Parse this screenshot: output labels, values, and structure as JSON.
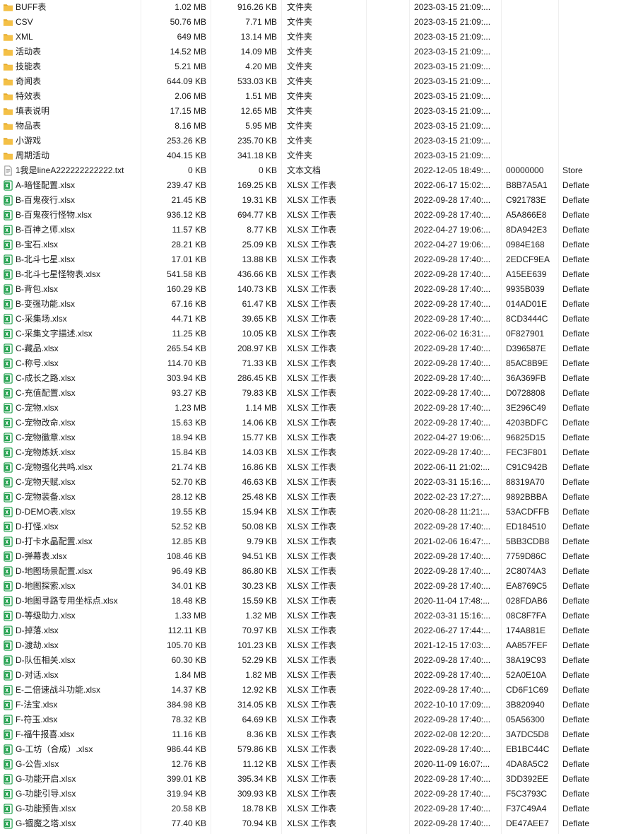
{
  "files": [
    {
      "name": "BUFF表",
      "size": "1.02 MB",
      "packed": "916.26 KB",
      "type": "文件夹",
      "modified": "2023-03-15 21:09:...",
      "crc": "",
      "method": "",
      "icon": "folder-icon"
    },
    {
      "name": "CSV",
      "size": "50.76 MB",
      "packed": "7.71 MB",
      "type": "文件夹",
      "modified": "2023-03-15 21:09:...",
      "crc": "",
      "method": "",
      "icon": "folder-icon"
    },
    {
      "name": "XML",
      "size": "649 MB",
      "packed": "13.14 MB",
      "type": "文件夹",
      "modified": "2023-03-15 21:09:...",
      "crc": "",
      "method": "",
      "icon": "folder-icon"
    },
    {
      "name": "活动表",
      "size": "14.52 MB",
      "packed": "14.09 MB",
      "type": "文件夹",
      "modified": "2023-03-15 21:09:...",
      "crc": "",
      "method": "",
      "icon": "folder-icon"
    },
    {
      "name": "技能表",
      "size": "5.21 MB",
      "packed": "4.20 MB",
      "type": "文件夹",
      "modified": "2023-03-15 21:09:...",
      "crc": "",
      "method": "",
      "icon": "folder-icon"
    },
    {
      "name": "奇闻表",
      "size": "644.09 KB",
      "packed": "533.03 KB",
      "type": "文件夹",
      "modified": "2023-03-15 21:09:...",
      "crc": "",
      "method": "",
      "icon": "folder-icon"
    },
    {
      "name": "特效表",
      "size": "2.06 MB",
      "packed": "1.51 MB",
      "type": "文件夹",
      "modified": "2023-03-15 21:09:...",
      "crc": "",
      "method": "",
      "icon": "folder-icon"
    },
    {
      "name": "填表说明",
      "size": "17.15 MB",
      "packed": "12.65 MB",
      "type": "文件夹",
      "modified": "2023-03-15 21:09:...",
      "crc": "",
      "method": "",
      "icon": "folder-icon"
    },
    {
      "name": "物品表",
      "size": "8.16 MB",
      "packed": "5.95 MB",
      "type": "文件夹",
      "modified": "2023-03-15 21:09:...",
      "crc": "",
      "method": "",
      "icon": "folder-icon"
    },
    {
      "name": "小游戏",
      "size": "253.26 KB",
      "packed": "235.70 KB",
      "type": "文件夹",
      "modified": "2023-03-15 21:09:...",
      "crc": "",
      "method": "",
      "icon": "folder-icon"
    },
    {
      "name": "周期活动",
      "size": "404.15 KB",
      "packed": "341.18 KB",
      "type": "文件夹",
      "modified": "2023-03-15 21:09:...",
      "crc": "",
      "method": "",
      "icon": "folder-icon"
    },
    {
      "name": "1我是lineA222222222222.txt",
      "size": "0 KB",
      "packed": "0 KB",
      "type": "文本文档",
      "modified": "2022-12-05 18:49:...",
      "crc": "00000000",
      "method": "Store",
      "icon": "text-file-icon"
    },
    {
      "name": "A-暗怪配置.xlsx",
      "size": "239.47 KB",
      "packed": "169.25 KB",
      "type": "XLSX 工作表",
      "modified": "2022-06-17 15:02:...",
      "crc": "B8B7A5A1",
      "method": "Deflate",
      "icon": "xlsx-file-icon"
    },
    {
      "name": "B-百鬼夜行.xlsx",
      "size": "21.45 KB",
      "packed": "19.31 KB",
      "type": "XLSX 工作表",
      "modified": "2022-09-28 17:40:...",
      "crc": "C921783E",
      "method": "Deflate",
      "icon": "xlsx-file-icon"
    },
    {
      "name": "B-百鬼夜行怪物.xlsx",
      "size": "936.12 KB",
      "packed": "694.77 KB",
      "type": "XLSX 工作表",
      "modified": "2022-09-28 17:40:...",
      "crc": "A5A866E8",
      "method": "Deflate",
      "icon": "xlsx-file-icon"
    },
    {
      "name": "B-百神之师.xlsx",
      "size": "11.57 KB",
      "packed": "8.77 KB",
      "type": "XLSX 工作表",
      "modified": "2022-04-27 19:06:...",
      "crc": "8DA942E3",
      "method": "Deflate",
      "icon": "xlsx-file-icon"
    },
    {
      "name": "B-宝石.xlsx",
      "size": "28.21 KB",
      "packed": "25.09 KB",
      "type": "XLSX 工作表",
      "modified": "2022-04-27 19:06:...",
      "crc": "0984E168",
      "method": "Deflate",
      "icon": "xlsx-file-icon"
    },
    {
      "name": "B-北斗七星.xlsx",
      "size": "17.01 KB",
      "packed": "13.88 KB",
      "type": "XLSX 工作表",
      "modified": "2022-09-28 17:40:...",
      "crc": "2EDCF9EA",
      "method": "Deflate",
      "icon": "xlsx-file-icon"
    },
    {
      "name": "B-北斗七星怪物表.xlsx",
      "size": "541.58 KB",
      "packed": "436.66 KB",
      "type": "XLSX 工作表",
      "modified": "2022-09-28 17:40:...",
      "crc": "A15EE639",
      "method": "Deflate",
      "icon": "xlsx-file-icon"
    },
    {
      "name": "B-背包.xlsx",
      "size": "160.29 KB",
      "packed": "140.73 KB",
      "type": "XLSX 工作表",
      "modified": "2022-09-28 17:40:...",
      "crc": "9935B039",
      "method": "Deflate",
      "icon": "xlsx-file-icon"
    },
    {
      "name": "B-变强功能.xlsx",
      "size": "67.16 KB",
      "packed": "61.47 KB",
      "type": "XLSX 工作表",
      "modified": "2022-09-28 17:40:...",
      "crc": "014AD01E",
      "method": "Deflate",
      "icon": "xlsx-file-icon"
    },
    {
      "name": "C-采集场.xlsx",
      "size": "44.71 KB",
      "packed": "39.65 KB",
      "type": "XLSX 工作表",
      "modified": "2022-09-28 17:40:...",
      "crc": "8CD3444C",
      "method": "Deflate",
      "icon": "xlsx-file-icon"
    },
    {
      "name": "C-采集文字描述.xlsx",
      "size": "11.25 KB",
      "packed": "10.05 KB",
      "type": "XLSX 工作表",
      "modified": "2022-06-02 16:31:...",
      "crc": "0F827901",
      "method": "Deflate",
      "icon": "xlsx-file-icon"
    },
    {
      "name": "C-藏品.xlsx",
      "size": "265.54 KB",
      "packed": "208.97 KB",
      "type": "XLSX 工作表",
      "modified": "2022-09-28 17:40:...",
      "crc": "D396587E",
      "method": "Deflate",
      "icon": "xlsx-file-icon"
    },
    {
      "name": "C-称号.xlsx",
      "size": "114.70 KB",
      "packed": "71.33 KB",
      "type": "XLSX 工作表",
      "modified": "2022-09-28 17:40:...",
      "crc": "85AC8B9E",
      "method": "Deflate",
      "icon": "xlsx-file-icon"
    },
    {
      "name": "C-成长之路.xlsx",
      "size": "303.94 KB",
      "packed": "286.45 KB",
      "type": "XLSX 工作表",
      "modified": "2022-09-28 17:40:...",
      "crc": "36A369FB",
      "method": "Deflate",
      "icon": "xlsx-file-icon"
    },
    {
      "name": "C-充值配置.xlsx",
      "size": "93.27 KB",
      "packed": "79.83 KB",
      "type": "XLSX 工作表",
      "modified": "2022-09-28 17:40:...",
      "crc": "D0728808",
      "method": "Deflate",
      "icon": "xlsx-file-icon"
    },
    {
      "name": "C-宠物.xlsx",
      "size": "1.23 MB",
      "packed": "1.14 MB",
      "type": "XLSX 工作表",
      "modified": "2022-09-28 17:40:...",
      "crc": "3E296C49",
      "method": "Deflate",
      "icon": "xlsx-file-icon"
    },
    {
      "name": "C-宠物改命.xlsx",
      "size": "15.63 KB",
      "packed": "14.06 KB",
      "type": "XLSX 工作表",
      "modified": "2022-09-28 17:40:...",
      "crc": "4203BDFC",
      "method": "Deflate",
      "icon": "xlsx-file-icon"
    },
    {
      "name": "C-宠物徽章.xlsx",
      "size": "18.94 KB",
      "packed": "15.77 KB",
      "type": "XLSX 工作表",
      "modified": "2022-04-27 19:06:...",
      "crc": "96825D15",
      "method": "Deflate",
      "icon": "xlsx-file-icon"
    },
    {
      "name": "C-宠物炼妖.xlsx",
      "size": "15.84 KB",
      "packed": "14.03 KB",
      "type": "XLSX 工作表",
      "modified": "2022-09-28 17:40:...",
      "crc": "FEC3F801",
      "method": "Deflate",
      "icon": "xlsx-file-icon"
    },
    {
      "name": "C-宠物强化共鸣.xlsx",
      "size": "21.74 KB",
      "packed": "16.86 KB",
      "type": "XLSX 工作表",
      "modified": "2022-06-11 21:02:...",
      "crc": "C91C942B",
      "method": "Deflate",
      "icon": "xlsx-file-icon"
    },
    {
      "name": "C-宠物天赋.xlsx",
      "size": "52.70 KB",
      "packed": "46.63 KB",
      "type": "XLSX 工作表",
      "modified": "2022-03-31 15:16:...",
      "crc": "88319A70",
      "method": "Deflate",
      "icon": "xlsx-file-icon"
    },
    {
      "name": "C-宠物装备.xlsx",
      "size": "28.12 KB",
      "packed": "25.48 KB",
      "type": "XLSX 工作表",
      "modified": "2022-02-23 17:27:...",
      "crc": "9892BBBA",
      "method": "Deflate",
      "icon": "xlsx-file-icon"
    },
    {
      "name": "D-DEMO表.xlsx",
      "size": "19.55 KB",
      "packed": "15.94 KB",
      "type": "XLSX 工作表",
      "modified": "2020-08-28 11:21:...",
      "crc": "53ACDFFB",
      "method": "Deflate",
      "icon": "xlsx-file-icon"
    },
    {
      "name": "D-打怪.xlsx",
      "size": "52.52 KB",
      "packed": "50.08 KB",
      "type": "XLSX 工作表",
      "modified": "2022-09-28 17:40:...",
      "crc": "ED184510",
      "method": "Deflate",
      "icon": "xlsx-file-icon"
    },
    {
      "name": "D-打卡水晶配置.xlsx",
      "size": "12.85 KB",
      "packed": "9.79 KB",
      "type": "XLSX 工作表",
      "modified": "2021-02-06 16:47:...",
      "crc": "5BB3CDB8",
      "method": "Deflate",
      "icon": "xlsx-file-icon"
    },
    {
      "name": "D-弹幕表.xlsx",
      "size": "108.46 KB",
      "packed": "94.51 KB",
      "type": "XLSX 工作表",
      "modified": "2022-09-28 17:40:...",
      "crc": "7759D86C",
      "method": "Deflate",
      "icon": "xlsx-file-icon"
    },
    {
      "name": "D-地图场景配置.xlsx",
      "size": "96.49 KB",
      "packed": "86.80 KB",
      "type": "XLSX 工作表",
      "modified": "2022-09-28 17:40:...",
      "crc": "2C8074A3",
      "method": "Deflate",
      "icon": "xlsx-file-icon"
    },
    {
      "name": "D-地图探索.xlsx",
      "size": "34.01 KB",
      "packed": "30.23 KB",
      "type": "XLSX 工作表",
      "modified": "2022-09-28 17:40:...",
      "crc": "EA8769C5",
      "method": "Deflate",
      "icon": "xlsx-file-icon"
    },
    {
      "name": "D-地图寻路专用坐标点.xlsx",
      "size": "18.48 KB",
      "packed": "15.59 KB",
      "type": "XLSX 工作表",
      "modified": "2020-11-04 17:48:...",
      "crc": "028FDAB6",
      "method": "Deflate",
      "icon": "xlsx-file-icon"
    },
    {
      "name": "D-等级助力.xlsx",
      "size": "1.33 MB",
      "packed": "1.32 MB",
      "type": "XLSX 工作表",
      "modified": "2022-03-31 15:16:...",
      "crc": "08C8F7FA",
      "method": "Deflate",
      "icon": "xlsx-file-icon"
    },
    {
      "name": "D-掉落.xlsx",
      "size": "112.11 KB",
      "packed": "70.97 KB",
      "type": "XLSX 工作表",
      "modified": "2022-06-27 17:44:...",
      "crc": "174A881E",
      "method": "Deflate",
      "icon": "xlsx-file-icon"
    },
    {
      "name": "D-渡劫.xlsx",
      "size": "105.70 KB",
      "packed": "101.23 KB",
      "type": "XLSX 工作表",
      "modified": "2021-12-15 17:03:...",
      "crc": "AA857FEF",
      "method": "Deflate",
      "icon": "xlsx-file-icon"
    },
    {
      "name": "D-队伍相关.xlsx",
      "size": "60.30 KB",
      "packed": "52.29 KB",
      "type": "XLSX 工作表",
      "modified": "2022-09-28 17:40:...",
      "crc": "38A19C93",
      "method": "Deflate",
      "icon": "xlsx-file-icon"
    },
    {
      "name": "D-对话.xlsx",
      "size": "1.84 MB",
      "packed": "1.82 MB",
      "type": "XLSX 工作表",
      "modified": "2022-09-28 17:40:...",
      "crc": "52A0E10A",
      "method": "Deflate",
      "icon": "xlsx-file-icon"
    },
    {
      "name": "E-二倍速战斗功能.xlsx",
      "size": "14.37 KB",
      "packed": "12.92 KB",
      "type": "XLSX 工作表",
      "modified": "2022-09-28 17:40:...",
      "crc": "CD6F1C69",
      "method": "Deflate",
      "icon": "xlsx-file-icon"
    },
    {
      "name": "F-法宝.xlsx",
      "size": "384.98 KB",
      "packed": "314.05 KB",
      "type": "XLSX 工作表",
      "modified": "2022-10-10 17:09:...",
      "crc": "3B820940",
      "method": "Deflate",
      "icon": "xlsx-file-icon"
    },
    {
      "name": "F-符玉.xlsx",
      "size": "78.32 KB",
      "packed": "64.69 KB",
      "type": "XLSX 工作表",
      "modified": "2022-09-28 17:40:...",
      "crc": "05A56300",
      "method": "Deflate",
      "icon": "xlsx-file-icon"
    },
    {
      "name": "F-福牛报喜.xlsx",
      "size": "11.16 KB",
      "packed": "8.36 KB",
      "type": "XLSX 工作表",
      "modified": "2022-02-08 12:20:...",
      "crc": "3A7DC5D8",
      "method": "Deflate",
      "icon": "xlsx-file-icon"
    },
    {
      "name": "G-工坊（合成）.xlsx",
      "size": "986.44 KB",
      "packed": "579.86 KB",
      "type": "XLSX 工作表",
      "modified": "2022-09-28 17:40:...",
      "crc": "EB1BC44C",
      "method": "Deflate",
      "icon": "xlsx-file-icon"
    },
    {
      "name": "G-公告.xlsx",
      "size": "12.76 KB",
      "packed": "11.12 KB",
      "type": "XLSX 工作表",
      "modified": "2020-11-09 16:07:...",
      "crc": "4DA8A5C2",
      "method": "Deflate",
      "icon": "xlsx-file-icon"
    },
    {
      "name": "G-功能开启.xlsx",
      "size": "399.01 KB",
      "packed": "395.34 KB",
      "type": "XLSX 工作表",
      "modified": "2022-09-28 17:40:...",
      "crc": "3DD392EE",
      "method": "Deflate",
      "icon": "xlsx-file-icon"
    },
    {
      "name": "G-功能引导.xlsx",
      "size": "319.94 KB",
      "packed": "309.93 KB",
      "type": "XLSX 工作表",
      "modified": "2022-09-28 17:40:...",
      "crc": "F5C3793C",
      "method": "Deflate",
      "icon": "xlsx-file-icon"
    },
    {
      "name": "G-功能预告.xlsx",
      "size": "20.58 KB",
      "packed": "18.78 KB",
      "type": "XLSX 工作表",
      "modified": "2022-09-28 17:40:...",
      "crc": "F37C49A4",
      "method": "Deflate",
      "icon": "xlsx-file-icon"
    },
    {
      "name": "G-锢魔之塔.xlsx",
      "size": "77.40 KB",
      "packed": "70.94 KB",
      "type": "XLSX 工作表",
      "modified": "2022-09-28 17:40:...",
      "crc": "DE47AEE7",
      "method": "Deflate",
      "icon": "xlsx-file-icon"
    }
  ],
  "colors": {
    "folder": "#F4C046",
    "folder_dark": "#E4A92A",
    "xlsx": "#1E9E4A",
    "text_file": "#8A8A8A",
    "separator": "#EFEFEF"
  }
}
